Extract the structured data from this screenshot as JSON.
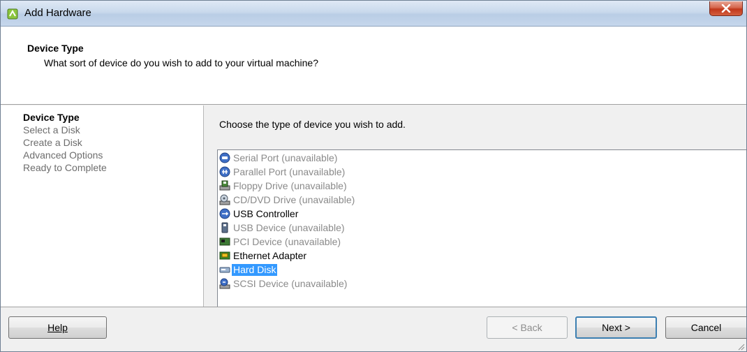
{
  "window": {
    "title": "Add Hardware"
  },
  "header": {
    "title": "Device Type",
    "subtitle": "What sort of device do you wish to add to your virtual machine?"
  },
  "steps": [
    {
      "label": "Device Type",
      "active": true
    },
    {
      "label": "Select a Disk",
      "active": false
    },
    {
      "label": "Create a Disk",
      "active": false
    },
    {
      "label": "Advanced Options",
      "active": false
    },
    {
      "label": "Ready to Complete",
      "active": false
    }
  ],
  "main": {
    "prompt": "Choose the type of device you wish to add.",
    "devices": [
      {
        "label": "Serial Port (unavailable)",
        "icon": "serial-port-icon",
        "available": false,
        "selected": false
      },
      {
        "label": "Parallel Port (unavailable)",
        "icon": "parallel-port-icon",
        "available": false,
        "selected": false
      },
      {
        "label": "Floppy Drive (unavailable)",
        "icon": "floppy-drive-icon",
        "available": false,
        "selected": false
      },
      {
        "label": "CD/DVD Drive (unavailable)",
        "icon": "cd-dvd-drive-icon",
        "available": false,
        "selected": false
      },
      {
        "label": "USB Controller",
        "icon": "usb-controller-icon",
        "available": true,
        "selected": false
      },
      {
        "label": "USB Device (unavailable)",
        "icon": "usb-device-icon",
        "available": false,
        "selected": false
      },
      {
        "label": "PCI Device (unavailable)",
        "icon": "pci-device-icon",
        "available": false,
        "selected": false
      },
      {
        "label": "Ethernet Adapter",
        "icon": "ethernet-adapter-icon",
        "available": true,
        "selected": false
      },
      {
        "label": "Hard Disk",
        "icon": "hard-disk-icon",
        "available": true,
        "selected": true
      },
      {
        "label": "SCSI Device (unavailable)",
        "icon": "scsi-device-icon",
        "available": false,
        "selected": false
      }
    ]
  },
  "footer": {
    "help_label": "Help",
    "back_label": "< Back",
    "next_label": "Next >",
    "cancel_label": "Cancel"
  },
  "colors": {
    "selection": "#3399ff",
    "close_button": "#c1371b",
    "disabled_text": "#8a8a8a"
  }
}
